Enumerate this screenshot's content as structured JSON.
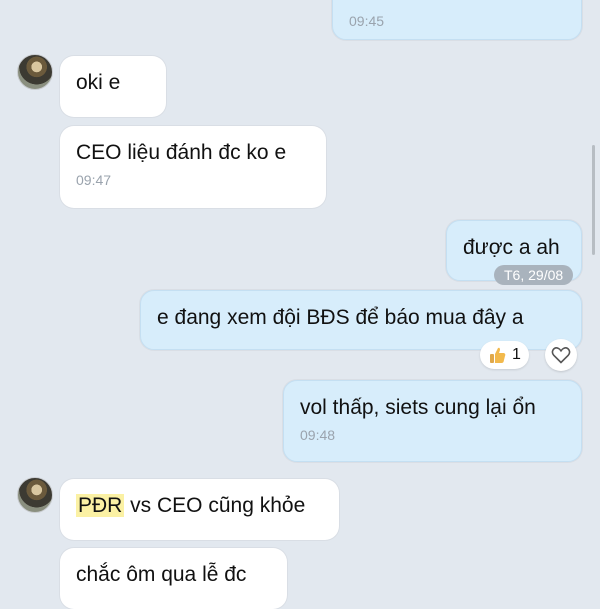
{
  "messages": {
    "m0_time": "09:45",
    "m1_text": "oki e",
    "m2_text": "CEO liệu đánh đc ko e",
    "m2_time": "09:47",
    "m3_text": "được a ah",
    "date_chip": "T6, 29/08",
    "m4_text": "e đang xem đội BĐS để báo mua đây a",
    "m4_reaction_count": "1",
    "m5_text": "vol thấp, siets cung lại ổn",
    "m5_time": "09:48",
    "m6_highlight": "PĐR",
    "m6_rest": " vs CEO cũng khỏe",
    "m7_text": "chắc ôm qua lễ đc"
  },
  "icons": {
    "reaction": "thumbs-up-icon",
    "react_button": "heart-icon"
  }
}
